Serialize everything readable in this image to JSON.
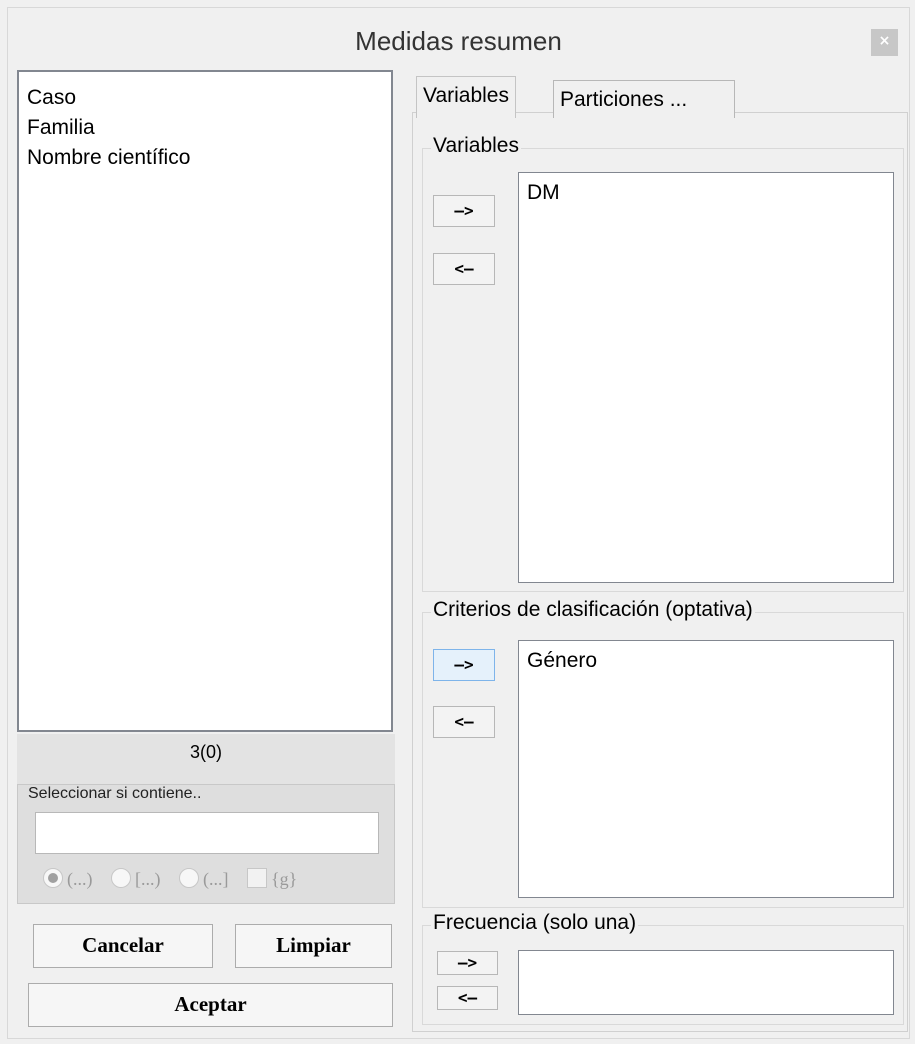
{
  "window": {
    "title": "Medidas resumen",
    "close_label": "×"
  },
  "left": {
    "items": [
      "Caso",
      "Familia",
      "Nombre científico"
    ],
    "count": "3(0)",
    "filter": {
      "label": "Seleccionar si contiene..",
      "value": "",
      "options": [
        "(...)",
        "[...)",
        "(...]",
        "{g}"
      ]
    },
    "buttons": {
      "cancel": "Cancelar",
      "clear": "Limpiar",
      "accept": "Aceptar"
    }
  },
  "tabs": [
    {
      "label": "Variables",
      "active": true
    },
    {
      "label": "Particiones ...",
      "active": false
    }
  ],
  "variables": {
    "label": "Variables",
    "add": "–>",
    "remove": "<–",
    "items": [
      "DM"
    ]
  },
  "criterios": {
    "label": "Criterios de clasificación (optativa)",
    "add": "–>",
    "remove": "<–",
    "items": [
      "Género"
    ]
  },
  "frecuencia": {
    "label": "Frecuencia (solo una)",
    "add": "–>",
    "remove": "<–",
    "value": ""
  }
}
